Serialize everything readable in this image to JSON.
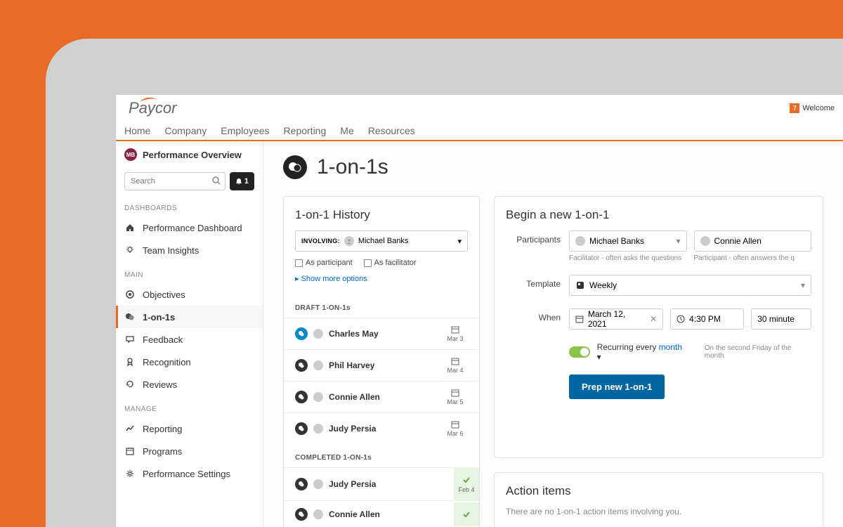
{
  "brand": "Paycor",
  "welcome": {
    "badge": "7",
    "text": "Welcome"
  },
  "nav": [
    "Home",
    "Company",
    "Employees",
    "Reporting",
    "Me",
    "Resources"
  ],
  "sidebar": {
    "badge": "MB",
    "title": "Performance Overview",
    "search_placeholder": "Search",
    "notif_count": "1",
    "sections": {
      "dashboards": {
        "label": "DASHBOARDS",
        "items": [
          "Performance Dashboard",
          "Team Insights"
        ]
      },
      "main": {
        "label": "MAIN",
        "items": [
          "Objectives",
          "1-on-1s",
          "Feedback",
          "Recognition",
          "Reviews"
        ]
      },
      "manage": {
        "label": "MANAGE",
        "items": [
          "Reporting",
          "Programs",
          "Performance Settings"
        ]
      }
    }
  },
  "page": {
    "title": "1-on-1s"
  },
  "history": {
    "title": "1-on-1 History",
    "involving_label": "INVOLVING:",
    "involving_name": "Michael Banks",
    "chk_participant": "As participant",
    "chk_facilitator": "As facilitator",
    "show_more": "Show more options",
    "draft_label": "DRAFT 1-ON-1s",
    "completed_label": "COMPLETED 1-ON-1s",
    "drafts": [
      {
        "name": "Charles May",
        "date": "Mar 3",
        "blue": true
      },
      {
        "name": "Phil Harvey",
        "date": "Mar 4",
        "blue": false
      },
      {
        "name": "Connie Allen",
        "date": "Mar 5",
        "blue": false
      },
      {
        "name": "Judy Persia",
        "date": "Mar 6",
        "blue": false
      }
    ],
    "completed": [
      {
        "name": "Judy Persia",
        "date": "Feb 4"
      },
      {
        "name": "Connie Allen",
        "date": ""
      }
    ]
  },
  "new_form": {
    "title": "Begin a new 1-on-1",
    "labels": {
      "participants": "Participants",
      "template": "Template",
      "when": "When"
    },
    "facilitator": {
      "name": "Michael Banks",
      "hint": "Facilitator - often asks the questions"
    },
    "participant": {
      "name": "Connie Allen",
      "hint": "Participant - often answers the q"
    },
    "template": "Weekly",
    "date": "March 12, 2021",
    "time": "4:30 PM",
    "duration": "30 minute",
    "recurring_prefix": "Recurring every ",
    "recurring_link": "month",
    "recurring_hint": "On the second Friday of the month",
    "submit": "Prep new 1-on-1"
  },
  "action_items": {
    "title": "Action items",
    "empty": "There are no 1-on-1 action items involving you."
  }
}
